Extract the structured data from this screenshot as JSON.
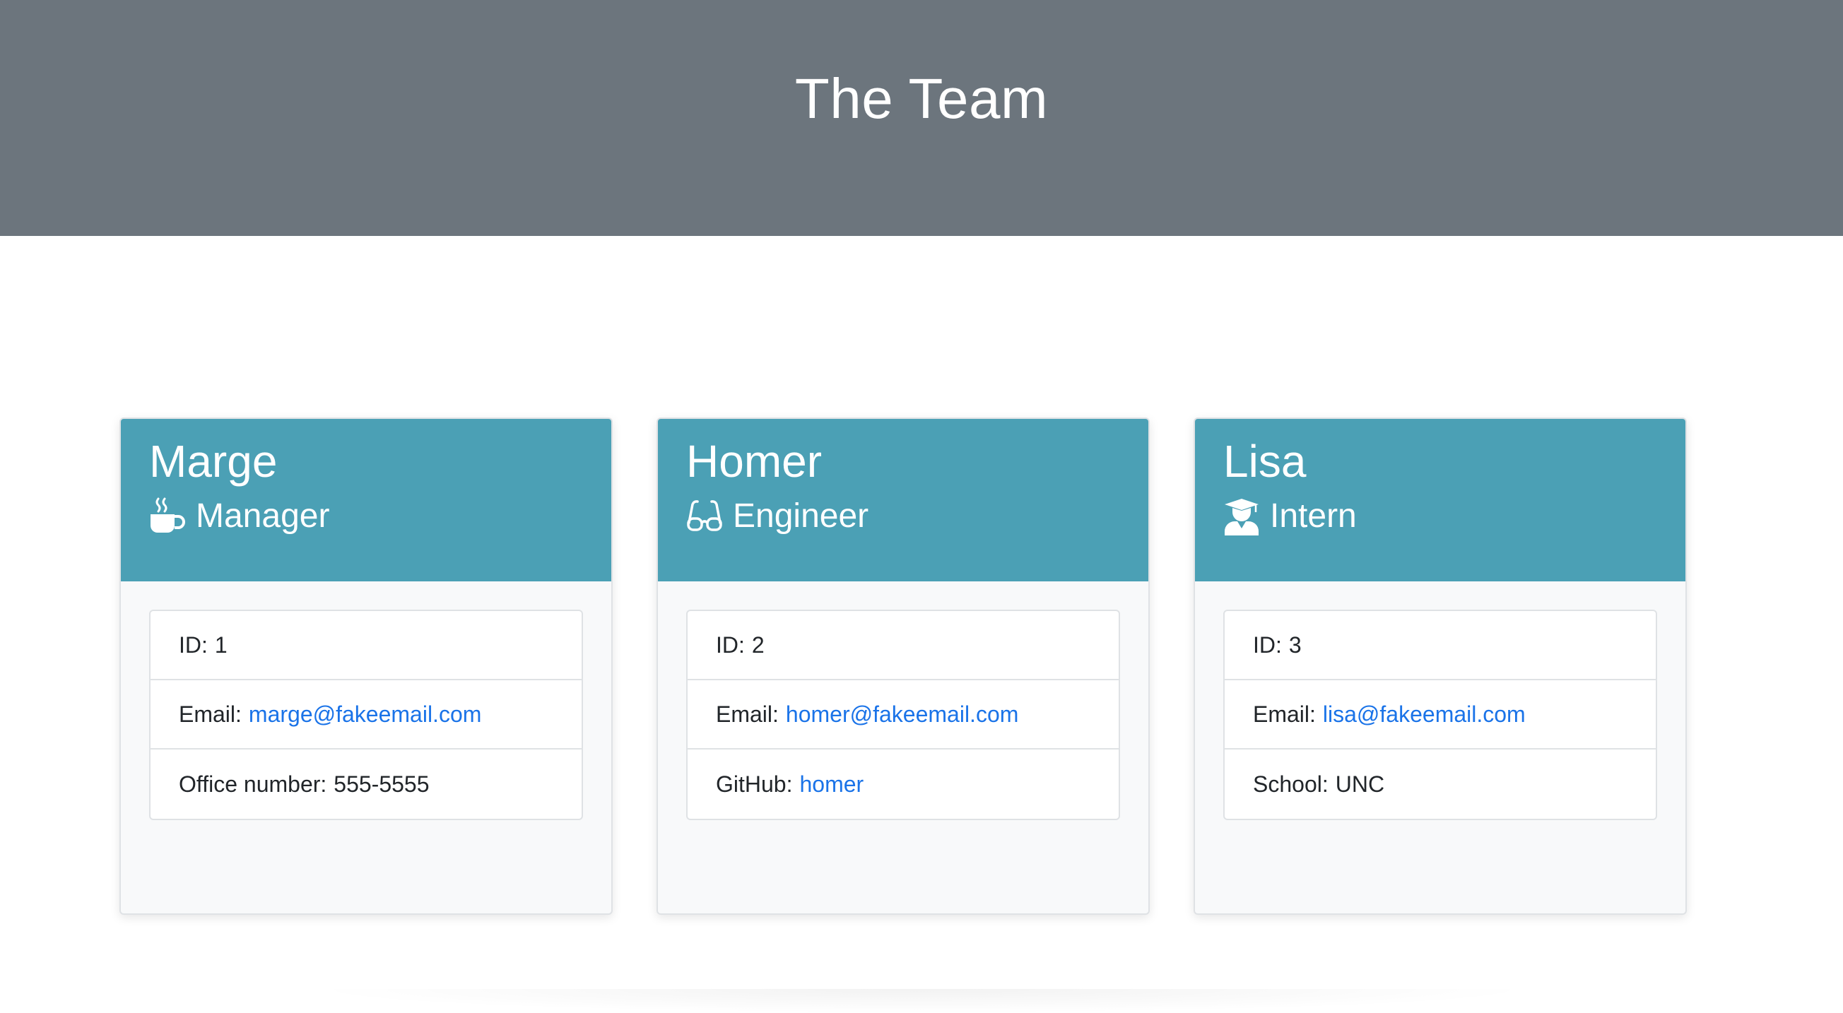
{
  "header": {
    "title": "The Team"
  },
  "employees": [
    {
      "name": "Marge",
      "role": "Manager",
      "role_icon": "coffee-mug-icon",
      "id_label": "ID:",
      "id_value": "1",
      "email_label": "Email:",
      "email": "marge@fakeemail.com",
      "extra_label": "Office number:",
      "extra_value": "555-5555"
    },
    {
      "name": "Homer",
      "role": "Engineer",
      "role_icon": "glasses-icon",
      "id_label": "ID:",
      "id_value": "2",
      "email_label": "Email:",
      "email": "homer@fakeemail.com",
      "extra_label": "GitHub:",
      "extra_value": "homer"
    },
    {
      "name": "Lisa",
      "role": "Intern",
      "role_icon": "graduate-icon",
      "id_label": "ID:",
      "id_value": "3",
      "email_label": "Email:",
      "email": "lisa@fakeemail.com",
      "extra_label": "School:",
      "extra_value": "UNC"
    }
  ],
  "colors": {
    "header_bg": "#6c757d",
    "card_header_bg": "#4ba0b5",
    "link": "#1a73e8"
  }
}
